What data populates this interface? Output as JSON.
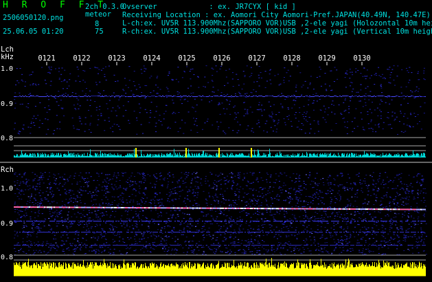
{
  "header": {
    "brand": "H R O F F T",
    "version": "2ch 0.3.0",
    "filename": "2506050120.png",
    "datetime": "25.06.05 01:20",
    "meteor_label": "meteor",
    "meteor_l": "8",
    "meteor_r": "75",
    "observer": "Ovserver            : ex. JR7CYX [ kid ]",
    "location": "Receiving Location : ex. Aomori City Aomori-Pref.JAPAN(40.49N, 140.47E)",
    "lch_info": "L-ch:ex. UV5R 113.900Mhz(SAPPORO VOR)USB ,2-ele yagi (Holozontal 10m height)",
    "rch_info": "R-ch:ex. UV5R 113.900Mhz(SAPPORO VOR)USB ,2-ele yagi (Vertical 10m height)"
  },
  "lch": {
    "label": "Lch",
    "unit": "kHz",
    "yticks": [
      "1.0",
      "0.9",
      "0.8"
    ]
  },
  "rch": {
    "label": "Rch",
    "yticks": [
      "1.0",
      "0.9",
      "0.8"
    ]
  },
  "time_ticks": [
    "0121",
    "0122",
    "0123",
    "0124",
    "0125",
    "0126",
    "0127",
    "0128",
    "0129",
    "0130"
  ],
  "colors": {
    "background": "#000000",
    "header_cyan": "#00e0e0",
    "brand_green": "#00ff00",
    "lch_noise_bars": "#00e0e0",
    "rch_noise_bars": "#ffff00",
    "signal_blue": "#3a3aff"
  }
}
